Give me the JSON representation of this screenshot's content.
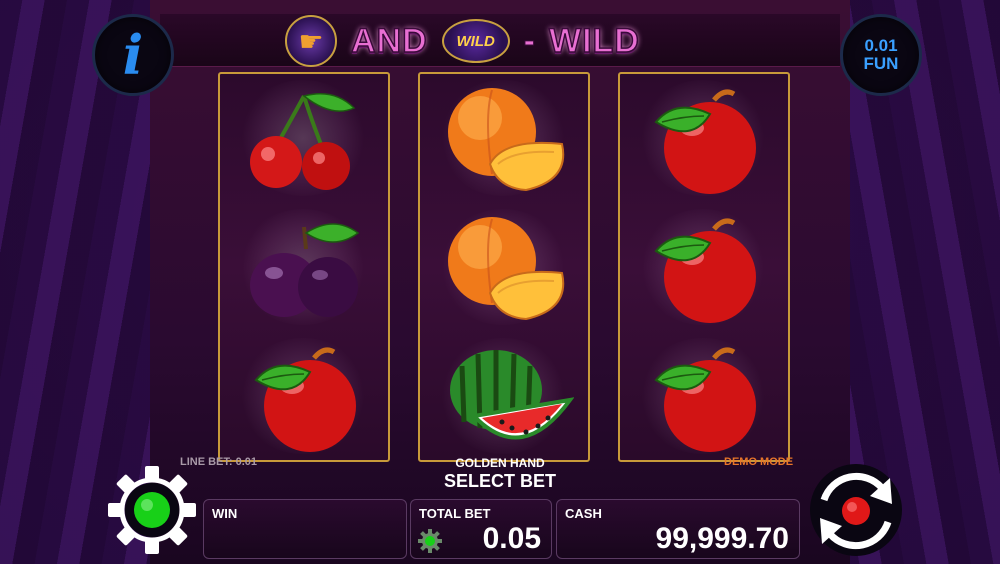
{
  "logo": {
    "word1": "AND",
    "wild_chip": "WILD",
    "dash": "-",
    "word2": "WILD",
    "hand_icon": "pointing-hand-icon"
  },
  "info_button": {
    "glyph": "i"
  },
  "coin_button": {
    "value": "0.01",
    "currency": "FUN"
  },
  "reels": [
    [
      "cherry",
      "plum",
      "apple"
    ],
    [
      "peach",
      "peach",
      "watermelon"
    ],
    [
      "apple",
      "apple",
      "apple"
    ]
  ],
  "labels": {
    "line_bet": "LINE BET: 0.01",
    "golden_hand": "GOLDEN HAND",
    "demo_mode": "DEMO MODE",
    "select_bet": "SELECT BET"
  },
  "panels": {
    "win": {
      "label": "WIN",
      "value": ""
    },
    "total_bet": {
      "label": "TOTAL BET",
      "value": "0.05"
    },
    "cash": {
      "label": "CASH",
      "value": "99,999.70"
    }
  },
  "colors": {
    "reel_border": "#c89a3a",
    "logo_pink": "#e86fd2",
    "demo_orange": "#e8762a",
    "accent_blue": "#2a8cf0",
    "status_green": "#18d018",
    "spin_red": "#e01818"
  }
}
